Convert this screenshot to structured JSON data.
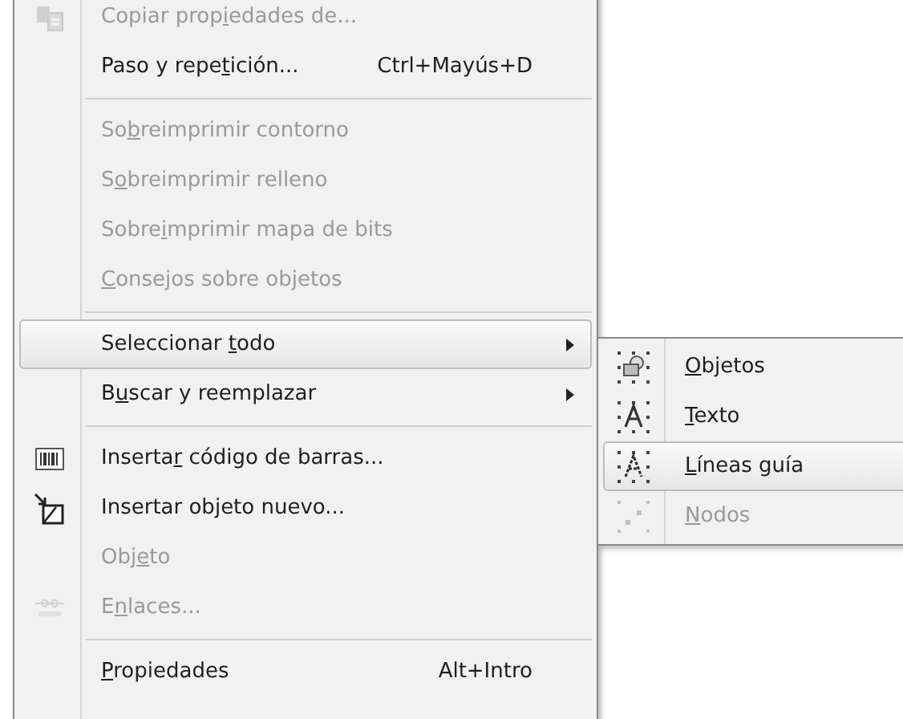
{
  "menu": {
    "items": [
      {
        "kind": "item",
        "label": {
          "before": "Copiar prop",
          "key": "i",
          "after": "edades de..."
        },
        "disabled": true,
        "selected": false
      },
      {
        "kind": "item",
        "label": {
          "before": "Paso y repe",
          "key": "t",
          "after": "ición..."
        },
        "shortcut": "Ctrl+Mayús+D",
        "disabled": false,
        "selected": false
      },
      {
        "kind": "separator"
      },
      {
        "kind": "item",
        "label": {
          "before": "So",
          "key": "b",
          "after": "reimprimir contorno"
        },
        "disabled": true,
        "selected": false
      },
      {
        "kind": "item",
        "label": {
          "before": "S",
          "key": "o",
          "after": "breimprimir relleno"
        },
        "disabled": true,
        "selected": false
      },
      {
        "kind": "item",
        "label": {
          "before": "Sobre",
          "key": "i",
          "after": "mprimir mapa de bits"
        },
        "disabled": true,
        "selected": false
      },
      {
        "kind": "item",
        "label": {
          "key": "C",
          "after": "onsejos sobre objetos"
        },
        "disabled": true,
        "selected": false
      },
      {
        "kind": "separator"
      },
      {
        "kind": "item",
        "label": {
          "before": "Seleccionar ",
          "key": "t",
          "after": "odo"
        },
        "submenu": true,
        "disabled": false,
        "selected": true
      },
      {
        "kind": "item",
        "label": {
          "before": "B",
          "key": "u",
          "after": "scar y reemplazar"
        },
        "submenu": true,
        "disabled": false,
        "selected": false
      },
      {
        "kind": "separator"
      },
      {
        "kind": "item",
        "label": {
          "before": "Inserta",
          "key": "r",
          "after": " código de barras..."
        },
        "disabled": false,
        "selected": false
      },
      {
        "kind": "item",
        "label": {
          "before": "Insertar ob",
          "key": "j",
          "after": "eto nuevo..."
        },
        "disabled": false,
        "selected": false
      },
      {
        "kind": "item",
        "label": {
          "before": "Obj",
          "key": "e",
          "after": "to"
        },
        "disabled": true,
        "selected": false
      },
      {
        "kind": "item",
        "label": {
          "before": "E",
          "key": "n",
          "after": "laces..."
        },
        "disabled": true,
        "selected": false
      },
      {
        "kind": "separator"
      },
      {
        "kind": "item",
        "label": {
          "key": "P",
          "after": "ropiedades"
        },
        "shortcut": "Alt+Intro",
        "disabled": false,
        "selected": false
      }
    ]
  },
  "submenu": {
    "items": [
      {
        "label": {
          "key": "O",
          "after": "bjetos"
        },
        "disabled": false,
        "selected": false
      },
      {
        "label": {
          "key": "T",
          "after": "exto"
        },
        "disabled": false,
        "selected": false
      },
      {
        "label": {
          "key": "L",
          "after": "íneas guía"
        },
        "disabled": false,
        "selected": true
      },
      {
        "label": {
          "key": "N",
          "after": "odos"
        },
        "disabled": true,
        "selected": false
      }
    ]
  }
}
